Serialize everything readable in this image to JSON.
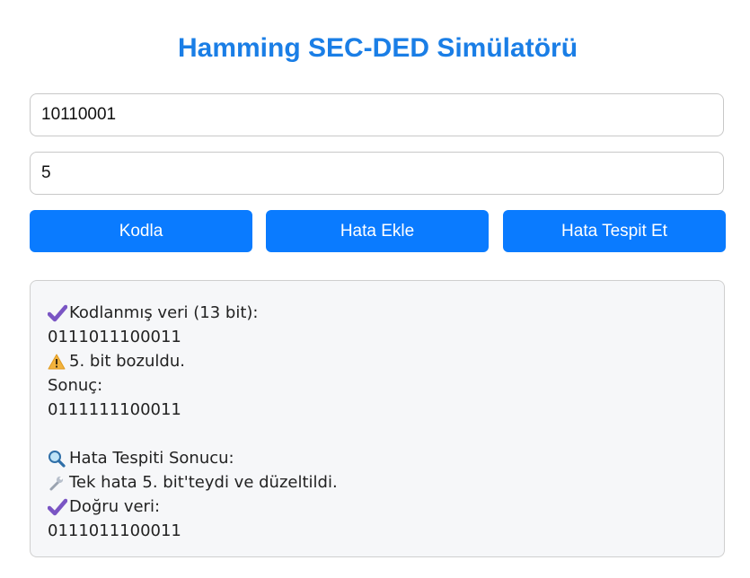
{
  "title": "Hamming SEC-DED Simülatörü",
  "inputs": {
    "data_value": "10110001",
    "error_bit_value": "5"
  },
  "buttons": {
    "encode": "Kodla",
    "add_error": "Hata Ekle",
    "detect_error": "Hata Tespit Et"
  },
  "output": {
    "encoded_label": "Kodlanmış veri (13 bit):",
    "encoded_value": "0111011100011",
    "corrupted_label": "5. bit bozuldu.",
    "result_label": "Sonuç:",
    "corrupted_value": "0111111100011",
    "detection_label": "Hata Tespiti Sonucu:",
    "detection_message": "Tek hata 5. bit'teydi ve düzeltildi.",
    "correct_label": "Doğru veri:",
    "correct_value": "0111011100011"
  },
  "icons": {
    "check": "check-mark-icon",
    "warning": "warning-icon",
    "search": "magnifier-icon",
    "wrench": "wrench-icon"
  },
  "colors": {
    "title": "#1a7ee6",
    "button": "#0a7bff",
    "check": "#7a55c4",
    "warning": "#f2b33d"
  }
}
